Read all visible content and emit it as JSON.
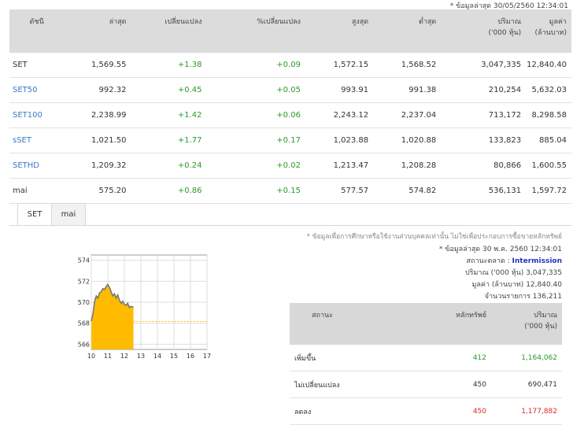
{
  "timestamp": "* ข้อมูลล่าสุด 30/05/2560 12:34:01",
  "table": {
    "headers": [
      "ดัชนี",
      "ล่าสุด",
      "เปลี่ยนแปลง",
      "%เปลี่ยนแปลง",
      "สูงสุด",
      "ต่ำสุด",
      "ปริมาณ\n('000 หุ้น)",
      "มูลค่า\n(ล้านบาท)"
    ],
    "rows": [
      {
        "name": "SET",
        "last": "1,569.55",
        "chg": "+1.38",
        "pct": "+0.09",
        "high": "1,572.15",
        "low": "1,568.52",
        "vol": "3,047,335",
        "val": "12,840.40"
      },
      {
        "name": "SET50",
        "last": "992.32",
        "chg": "+0.45",
        "pct": "+0.05",
        "high": "993.91",
        "low": "991.38",
        "vol": "210,254",
        "val": "5,632.03"
      },
      {
        "name": "SET100",
        "last": "2,238.99",
        "chg": "+1.42",
        "pct": "+0.06",
        "high": "2,243.12",
        "low": "2,237.04",
        "vol": "713,172",
        "val": "8,298.58"
      },
      {
        "name": "sSET",
        "last": "1,021.50",
        "chg": "+1.77",
        "pct": "+0.17",
        "high": "1,023.88",
        "low": "1,020.88",
        "vol": "133,823",
        "val": "885.04"
      },
      {
        "name": "SETHD",
        "last": "1,209.32",
        "chg": "+0.24",
        "pct": "+0.02",
        "high": "1,213.47",
        "low": "1,208.28",
        "vol": "80,866",
        "val": "1,600.55"
      },
      {
        "name": "mai",
        "last": "575.20",
        "chg": "+0.86",
        "pct": "+0.15",
        "high": "577.57",
        "low": "574.82",
        "vol": "536,131",
        "val": "1,597.72"
      }
    ]
  },
  "tabs": [
    "SET",
    "mai"
  ],
  "note": "* ข้อมูลเพื่อการศึกษาหรือใช้งานส่วนบุคคลเท่านั้น ไม่ใช่เพื่อประกอบการซื้อขายหลักทรัพย์",
  "info": {
    "date": "* ข้อมูลล่าสุด 30 พ.ค. 2560 12:34:01",
    "status_label": "สถานะตลาด :",
    "status_value": "Intermission",
    "volume_label": "ปริมาณ ('000 หุ้น)",
    "volume_value": "3,047,335",
    "value_label": "มูลค่า (ล้านบาท)",
    "value_value": "12,840.40",
    "trades_label": "จำนวนรายการ",
    "trades_value": "136,211"
  },
  "stats": {
    "headers": [
      "สถานะ",
      "หลักทรัพย์",
      "ปริมาณ\n('000 หุ้น)"
    ],
    "rows": [
      {
        "label": "เพิ่มขึ้น",
        "count": "412",
        "volume": "1,164,062",
        "color": "#2a9a2a"
      },
      {
        "label": "ไม่เปลี่ยนแปลง",
        "count": "450",
        "volume": "690,471",
        "color": "#333333"
      },
      {
        "label": "ลดลง",
        "count": "450",
        "volume": "1,177,882",
        "color": "#d62b2b"
      }
    ]
  },
  "chart_data": {
    "type": "area",
    "x_ticks": [
      "10",
      "11",
      "12",
      "13",
      "14",
      "15",
      "16",
      "17"
    ],
    "y_ticks": [
      "1574",
      "1572",
      "1570",
      "1568",
      "1566"
    ],
    "ylim": [
      1565.5,
      1574.5
    ],
    "xlim": [
      10,
      17
    ],
    "prev_close": 1568.17,
    "x": [
      10.0,
      10.1,
      10.2,
      10.3,
      10.4,
      10.5,
      10.6,
      10.7,
      10.8,
      10.9,
      11.0,
      11.1,
      11.2,
      11.3,
      11.4,
      11.5,
      11.6,
      11.7,
      11.8,
      11.9,
      12.0,
      12.1,
      12.2,
      12.3,
      12.4,
      12.55
    ],
    "y": [
      1568.2,
      1568.9,
      1570.1,
      1570.6,
      1570.4,
      1570.9,
      1571.0,
      1571.3,
      1571.2,
      1571.5,
      1571.7,
      1571.4,
      1571.0,
      1570.6,
      1570.8,
      1570.4,
      1570.7,
      1570.2,
      1569.9,
      1570.1,
      1569.8,
      1569.7,
      1569.9,
      1569.5,
      1569.6,
      1569.55
    ],
    "fill_color": "#ffbb00",
    "line_color": "#777777",
    "prev_line_color": "#ffbb00"
  }
}
